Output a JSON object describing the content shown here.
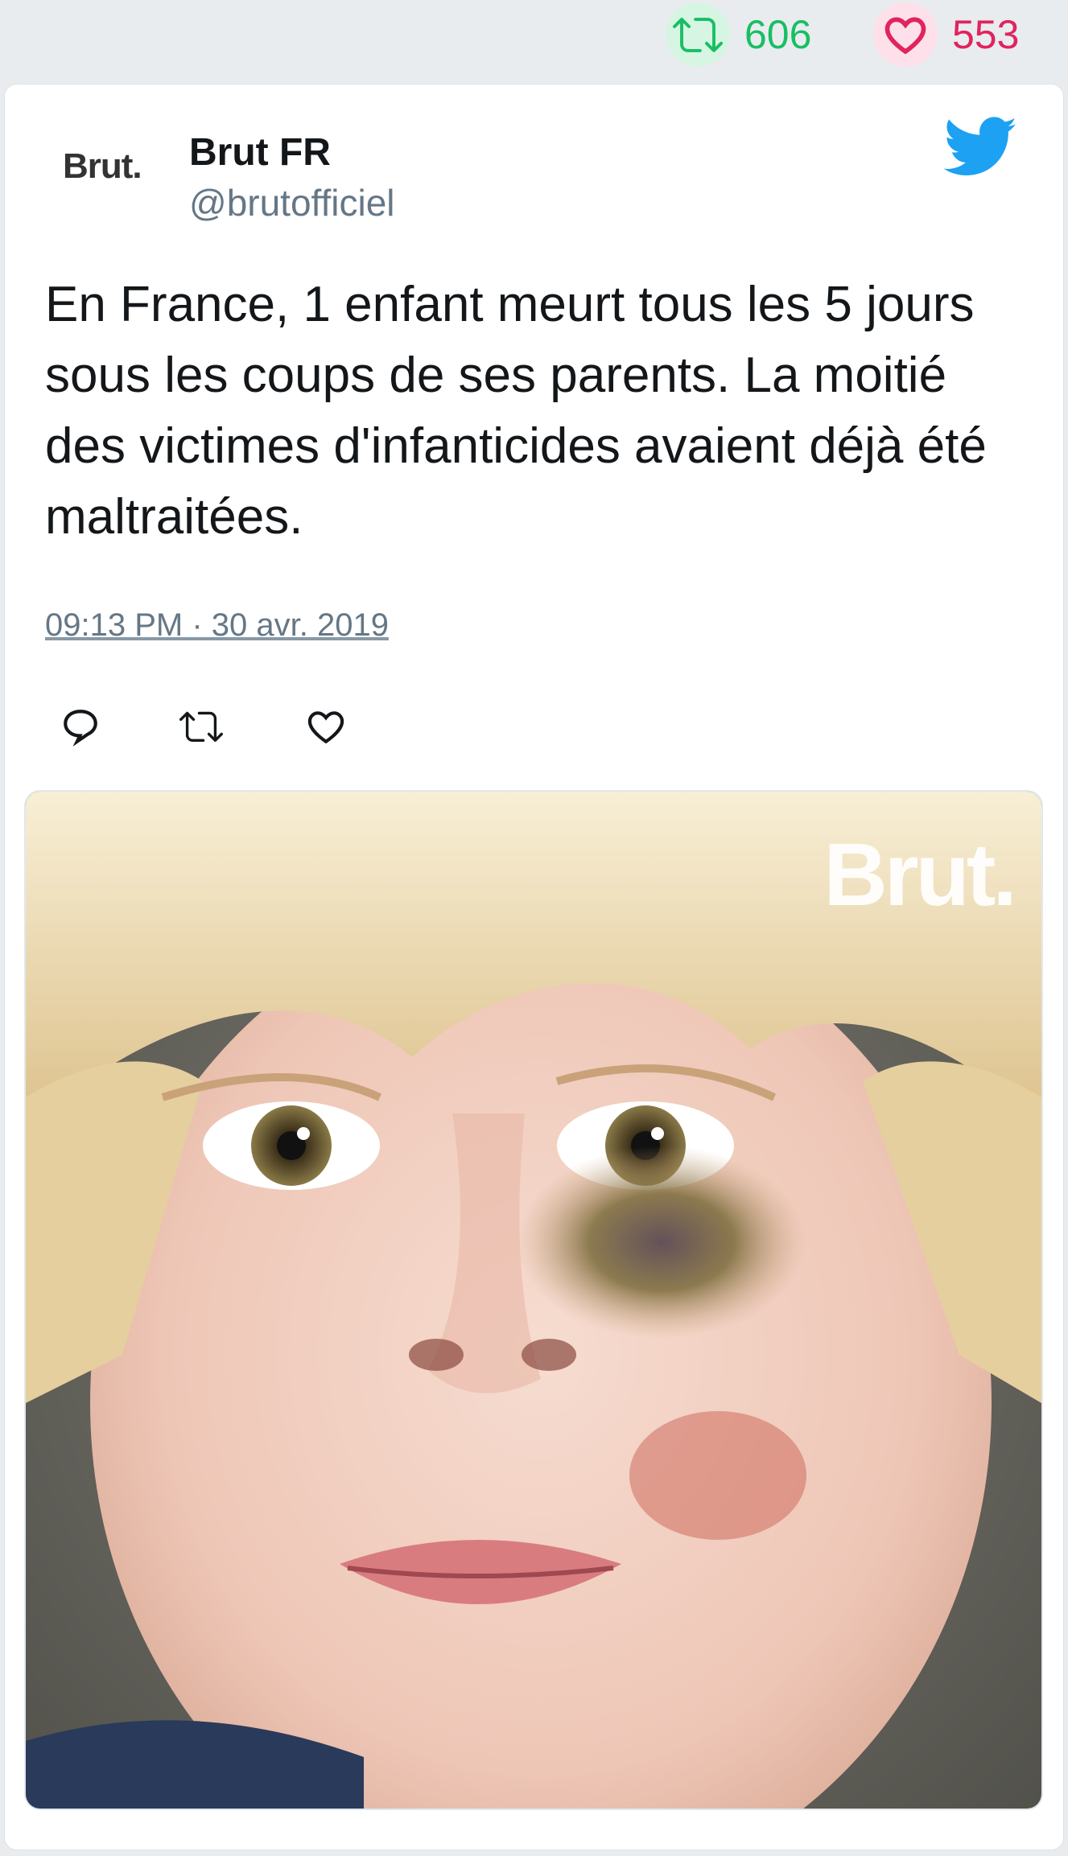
{
  "stats": {
    "retweets": "606",
    "likes": "553",
    "retweet_color": "#17bf63",
    "like_color": "#e0245e",
    "retweet_icon": "retweet-icon",
    "like_icon": "heart-icon"
  },
  "tweet": {
    "avatar_text": "Brut.",
    "author_name": "Brut FR",
    "author_handle": "@brutofficiel",
    "text": "En France, 1 enfant meurt tous les 5 jours sous les coups de ses parents. La moitié des victimes d'infanticides avaient déjà été maltraitées.",
    "timestamp": "09:13 PM · 30 avr. 2019",
    "brand_icon": "twitter-bird-icon",
    "brand_color": "#1da1f2"
  },
  "actions": [
    {
      "icon": "reply-icon"
    },
    {
      "icon": "retweet-icon"
    },
    {
      "icon": "like-icon"
    }
  ],
  "media": {
    "watermark": "Brut."
  }
}
